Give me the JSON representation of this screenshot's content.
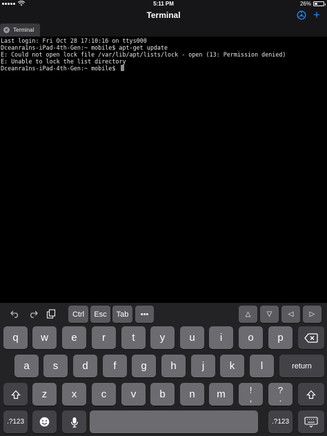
{
  "status_bar": {
    "time": "5:11 PM",
    "battery_label": "26%",
    "battery_level": 0.26,
    "icons": [
      "cellular-dots-icon",
      "wifi-icon",
      "battery-icon"
    ]
  },
  "nav_bar": {
    "title": "Terminal",
    "icons": [
      "settings-gear-icon",
      "add-tab-icon"
    ],
    "accent_color": "#1e8cff"
  },
  "tabs": [
    {
      "label": "Terminal",
      "icon": "close-tab-icon"
    }
  ],
  "terminal": {
    "lines": [
      "Last login: Fri Oct 28 17:10:16 on ttys000",
      "Dceanra1ns-iPad-4th-Gen:~ mobile$ apt-get update",
      "E: Could not open lock file /var/lib/apt/lists/lock - open (13: Permission denied)",
      "E: Unable to lock the list directory",
      "Dceanra1ns-iPad-4th-Gen:~ mobile$ "
    ]
  },
  "keyboard": {
    "assistant_bar": {
      "icons": [
        "undo-icon",
        "redo-icon",
        "paste-icon"
      ],
      "keys": [
        "Ctrl",
        "Esc",
        "Tab",
        "•••"
      ],
      "arrow_keys": [
        "△",
        "▽",
        "◁",
        "▷"
      ]
    },
    "row1": [
      "q",
      "w",
      "e",
      "r",
      "t",
      "y",
      "u",
      "i",
      "o",
      "p"
    ],
    "row2": [
      "a",
      "s",
      "d",
      "f",
      "g",
      "h",
      "j",
      "k",
      "l"
    ],
    "row3": [
      "z",
      "x",
      "c",
      "v",
      "b",
      "n",
      "m"
    ],
    "punct1": {
      "top": "!",
      "bottom": ","
    },
    "punct2": {
      "top": "?",
      "bottom": "."
    },
    "return_label": "return",
    "numbers_label": ".?123",
    "icons": [
      "backspace-icon",
      "shift-icon",
      "emoji-icon",
      "microphone-icon",
      "keyboard-dismiss-icon"
    ]
  }
}
